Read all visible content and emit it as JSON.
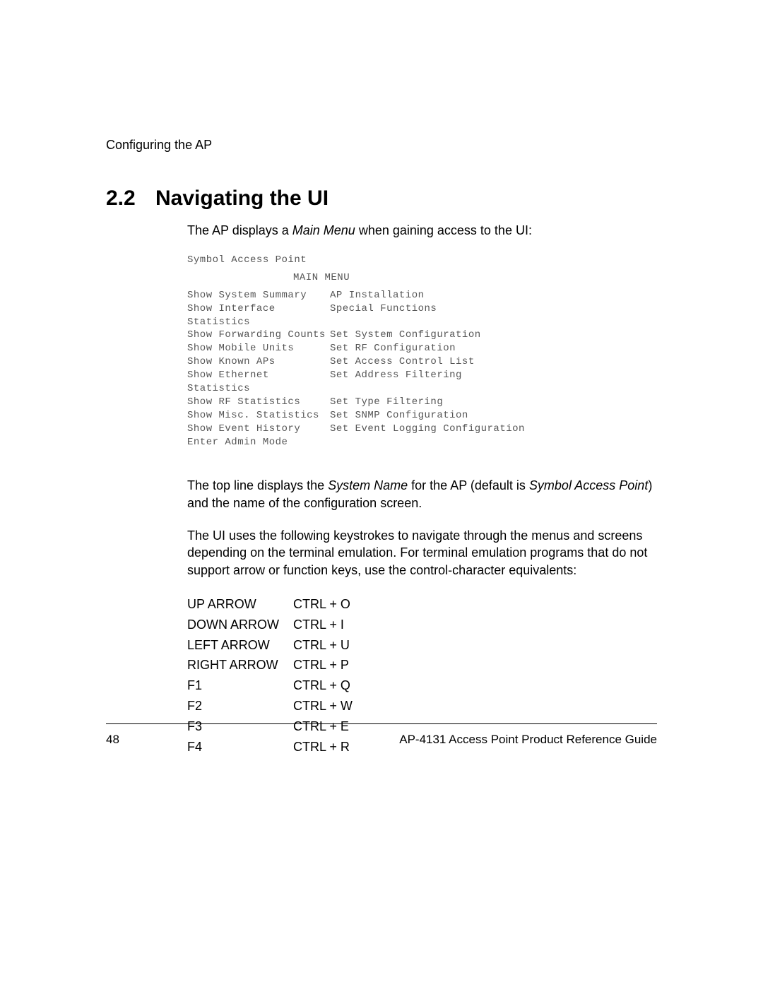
{
  "header": {
    "running_head": "Configuring the AP"
  },
  "section": {
    "number": "2.2",
    "title": "Navigating the UI"
  },
  "intro_pre": "The AP displays a ",
  "intro_em": "Main Menu",
  "intro_post": " when gaining access to the UI:",
  "terminal": {
    "system_name": "Symbol Access Point",
    "menu_label": "MAIN MENU",
    "rows": [
      {
        "left": "Show System Summary",
        "right": "AP Installation"
      },
      {
        "left": "Show Interface Statistics",
        "right": "Special Functions"
      },
      {
        "left": "Show Forwarding Counts",
        "right": "Set System Configuration"
      },
      {
        "left": "Show Mobile Units",
        "right": "Set RF Configuration"
      },
      {
        "left": "Show Known APs",
        "right": "Set Access Control List"
      },
      {
        "left": "Show Ethernet Statistics",
        "right": "Set Address Filtering"
      },
      {
        "left": "Show RF Statistics",
        "right": "Set Type Filtering"
      },
      {
        "left": "Show Misc. Statistics",
        "right": "Set SNMP Configuration"
      },
      {
        "left": "Show Event History",
        "right": "Set Event Logging Configuration"
      },
      {
        "left": "Enter Admin Mode",
        "right": ""
      }
    ]
  },
  "para1_a": "The top line displays the ",
  "para1_b": "System Name",
  "para1_c": " for the AP (default is ",
  "para1_d": "Symbol Access Point",
  "para1_e": ") and the name of the configuration screen.",
  "para2": "The UI uses the following keystrokes to navigate through the menus and screens depending on the terminal emulation. For terminal emulation programs that do not support arrow or function keys, use the control-character equivalents:",
  "keys": [
    {
      "k": "UP ARROW",
      "v": "CTRL + O"
    },
    {
      "k": "DOWN ARROW",
      "v": "CTRL + I"
    },
    {
      "k": "LEFT ARROW",
      "v": "CTRL + U"
    },
    {
      "k": "RIGHT ARROW",
      "v": "CTRL + P"
    },
    {
      "k": "F1",
      "v": "CTRL + Q"
    },
    {
      "k": "F2",
      "v": "CTRL + W"
    },
    {
      "k": "F3",
      "v": "CTRL + E"
    },
    {
      "k": "F4",
      "v": "CTRL + R"
    }
  ],
  "footer": {
    "page": "48",
    "doc": "AP-4131 Access Point Product Reference Guide"
  }
}
